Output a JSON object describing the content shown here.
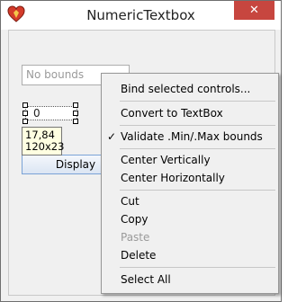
{
  "window": {
    "title": "NumericTextbox",
    "close_glyph": "✕"
  },
  "form": {
    "textbox1_placeholder": "No bounds",
    "textbox2_value": "0",
    "tooltip_line1": "17,84",
    "tooltip_line2": "120x23",
    "display_button_label": "Display"
  },
  "context_menu": {
    "items": [
      {
        "label": "Bind selected controls...",
        "checked": false,
        "enabled": true
      },
      {
        "label": "Convert to TextBox",
        "checked": false,
        "enabled": true
      },
      {
        "label": "Validate .Min/.Max bounds",
        "checked": true,
        "enabled": true
      },
      {
        "label": "Center Vertically",
        "checked": false,
        "enabled": true
      },
      {
        "label": "Center Horizontally",
        "checked": false,
        "enabled": true
      },
      {
        "label": "Cut",
        "checked": false,
        "enabled": true
      },
      {
        "label": "Copy",
        "checked": false,
        "enabled": true
      },
      {
        "label": "Paste",
        "checked": false,
        "enabled": false
      },
      {
        "label": "Delete",
        "checked": false,
        "enabled": true
      },
      {
        "label": "Select All",
        "checked": false,
        "enabled": true
      }
    ],
    "check_glyph": "✓"
  },
  "colors": {
    "close_button": "#c7463f",
    "tooltip_bg": "#ffffe1",
    "menu_bg": "#f0f0f0"
  },
  "icons": {
    "app": "heart-shield-icon",
    "close": "close-icon",
    "check": "checkmark-icon"
  }
}
